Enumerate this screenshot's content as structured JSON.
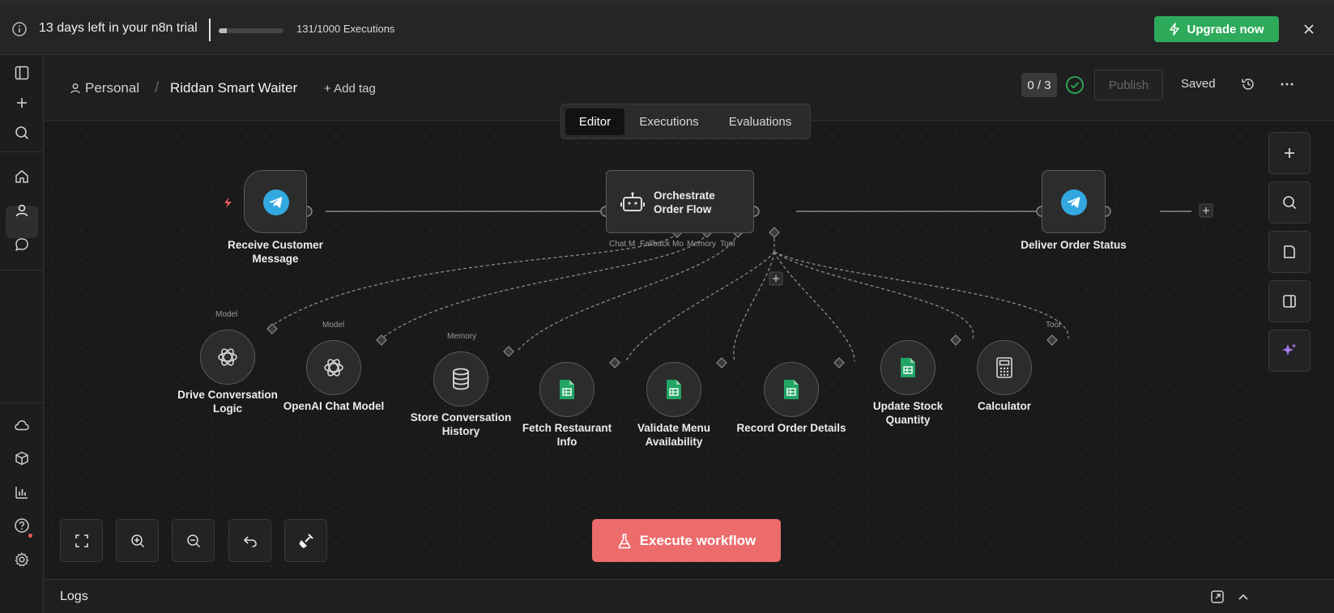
{
  "banner": {
    "trial_text": "13 days left in your n8n trial",
    "executions_text": "131/1000 Executions",
    "executions_used": 131,
    "executions_total": 1000,
    "upgrade_label": "Upgrade now",
    "upgrade_color": "#2dab5b"
  },
  "header": {
    "breadcrumb_project": "Personal",
    "workflow_name": "Riddan Smart Waiter",
    "add_tag_label": "+ Add tag",
    "version_counter": "0 / 3",
    "publish_label": "Publish",
    "saved_label": "Saved"
  },
  "tabs": [
    {
      "label": "Editor",
      "active": true
    },
    {
      "label": "Executions",
      "active": false
    },
    {
      "label": "Evaluations",
      "active": false
    }
  ],
  "nodes": {
    "trigger": {
      "label_line1": "Receive Customer",
      "label_line2": "Message",
      "icon": "telegram-icon"
    },
    "agent": {
      "label_line1": "Orchestrate",
      "label_line2": "Order Flow",
      "icon": "robot-icon"
    },
    "output": {
      "label": "Deliver Order Status",
      "icon": "telegram-icon"
    },
    "agent_handles": {
      "chat_model": "Chat M",
      "fallback_model": "Fallback Mo",
      "memory": "Memory",
      "tool": "Tool"
    },
    "sub_nodes": [
      {
        "handle_label": "Model",
        "label_line1": "Drive Conversation",
        "label_line2": "Logic",
        "icon": "openai-icon"
      },
      {
        "handle_label": "Model",
        "label_line1": "OpenAI Chat Model",
        "label_line2": "",
        "icon": "openai-icon"
      },
      {
        "handle_label": "Memory",
        "label_line1": "Store Conversation",
        "label_line2": "History",
        "icon": "database-icon"
      },
      {
        "handle_label": "",
        "label_line1": "Fetch Restaurant",
        "label_line2": "Info",
        "icon": "google-sheets-icon"
      },
      {
        "handle_label": "",
        "label_line1": "Validate Menu",
        "label_line2": "Availability",
        "icon": "google-sheets-icon"
      },
      {
        "handle_label": "",
        "label_line1": "Record Order Details",
        "label_line2": "",
        "icon": "google-sheets-icon"
      },
      {
        "handle_label": "",
        "label_line1": "Update Stock",
        "label_line2": "Quantity",
        "icon": "google-sheets-icon"
      },
      {
        "handle_label": "Tool",
        "label_line1": "Calculator",
        "label_line2": "",
        "icon": "calculator-icon"
      }
    ]
  },
  "execute_label": "Execute workflow",
  "execute_color": "#ec6b6b",
  "logs_label": "Logs"
}
